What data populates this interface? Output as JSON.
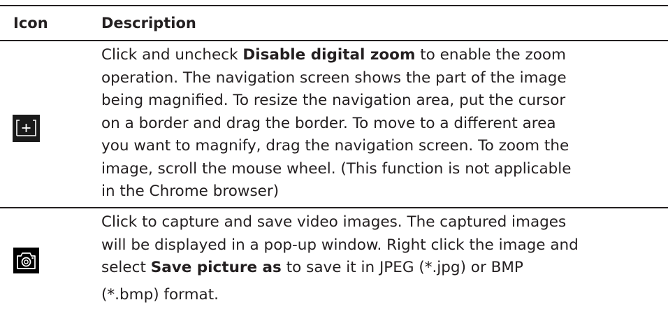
{
  "table": {
    "header": {
      "icon": "Icon",
      "description": "Description"
    },
    "rows": [
      {
        "icon": "zoom-plus-icon",
        "lines": [
          {
            "before": "Click and uncheck ",
            "bold": "Disable digital zoom",
            "after": " to enable the zoom"
          },
          {
            "text": "operation. The navigation screen shows the part of the image"
          },
          {
            "text": "being magnified. To resize the navigation area, put the cursor"
          },
          {
            "text": "on a border and drag the border. To move to a different area"
          },
          {
            "text": "you want to magnify, drag the navigation screen. To zoom the"
          },
          {
            "text": "image, scroll the mouse wheel. (This function is not applicable"
          },
          {
            "text": "in the Chrome browser)"
          }
        ]
      },
      {
        "icon": "camera-icon",
        "lines": [
          {
            "text": "Click to capture and save video images. The captured images"
          },
          {
            "text": "will be displayed in a pop-up window. Right click the image and"
          },
          {
            "before": "select ",
            "bold": "Save picture as",
            "after": " to save it in JPEG (*.jpg) or BMP"
          },
          {
            "text": "(*.bmp) format."
          }
        ]
      }
    ]
  }
}
